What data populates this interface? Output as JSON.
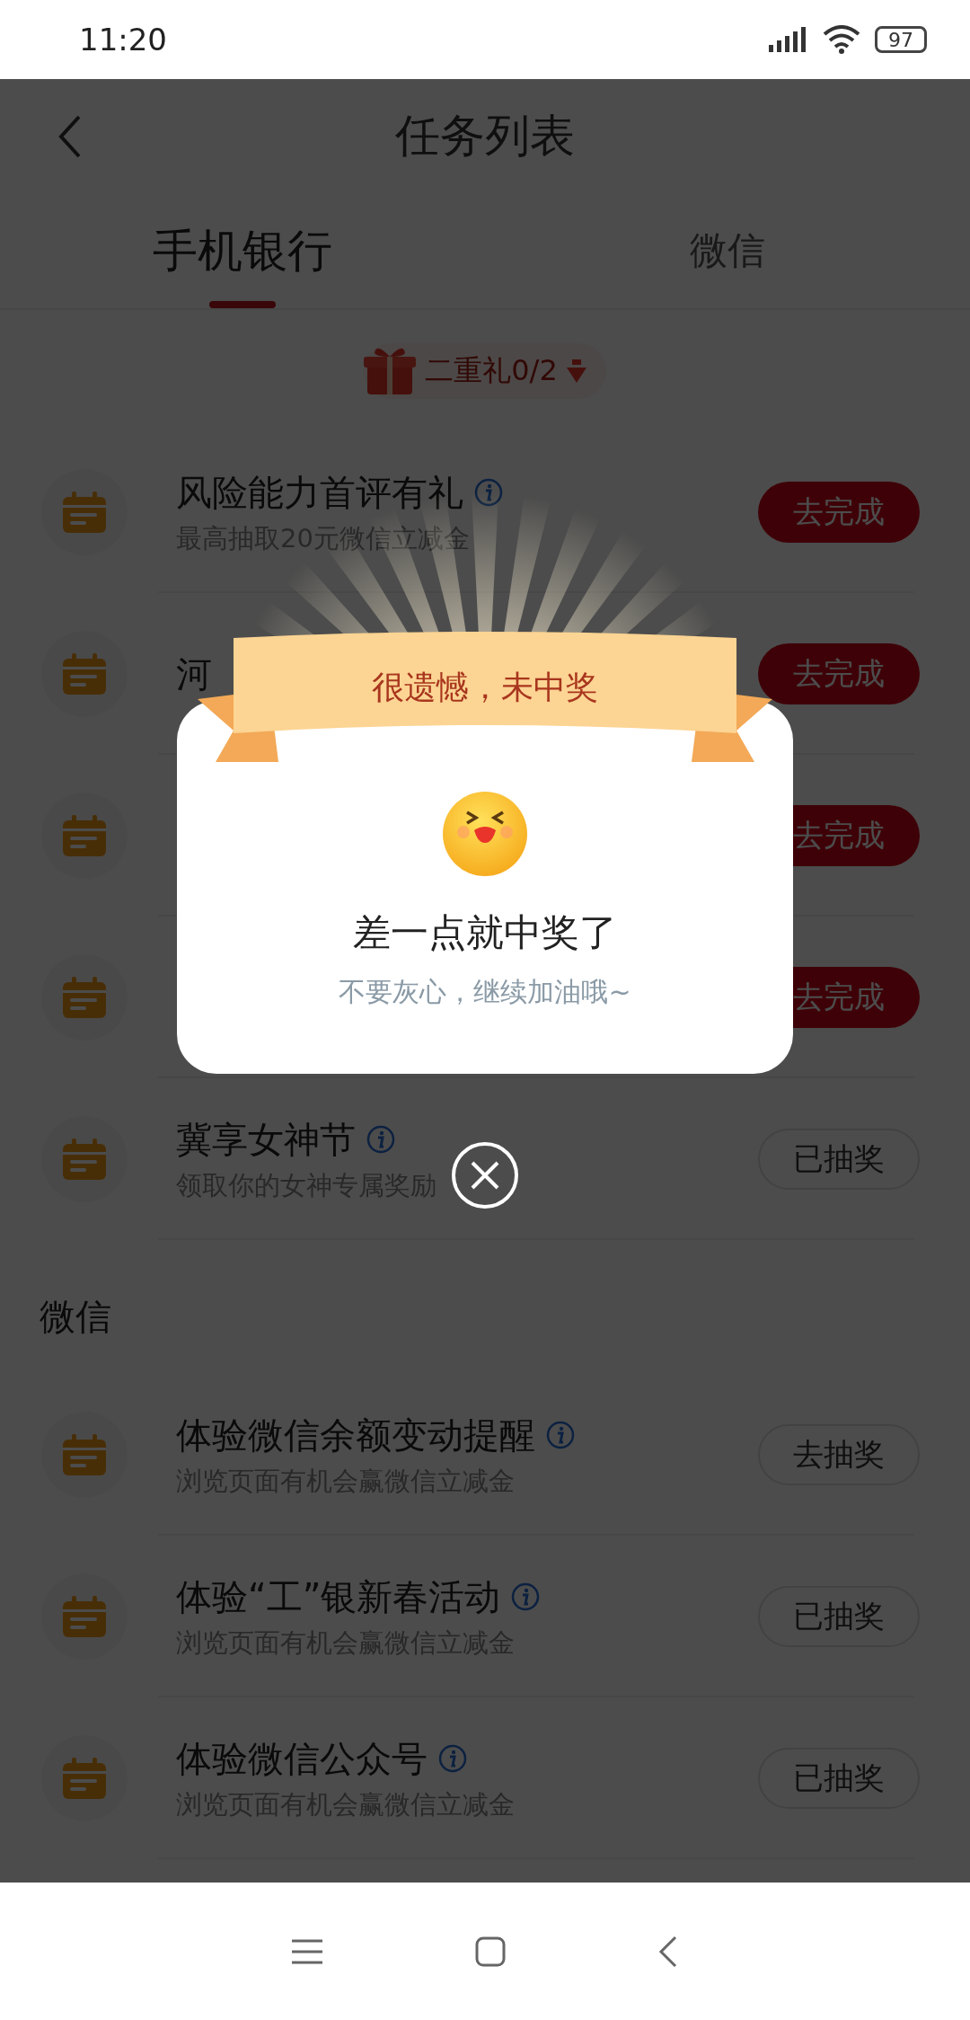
{
  "status_bar": {
    "time": "11:20",
    "battery": "97"
  },
  "header": {
    "title": "任务列表"
  },
  "tabs": [
    {
      "label": "手机银行",
      "selected": true
    },
    {
      "label": "微信",
      "selected": false
    }
  ],
  "gift_badge": {
    "label": "二重礼0/2"
  },
  "sections": [
    {
      "tasks": [
        {
          "title": "风险能力首评有礼",
          "info": true,
          "subtitle": "最高抽取20元微信立减金",
          "button": {
            "label": "去完成",
            "kind": "filled"
          }
        },
        {
          "title": "河",
          "info": false,
          "button": {
            "label": "去完成",
            "kind": "filled"
          }
        },
        {
          "info": false,
          "button": {
            "label": "去完成",
            "kind": "filled"
          }
        },
        {
          "info": false,
          "button": {
            "label": "去完成",
            "kind": "filled"
          }
        },
        {
          "title": "冀享女神节",
          "info": true,
          "subtitle": "领取你的女神专属奖励",
          "button": {
            "label": "已抽奖",
            "kind": "outline"
          }
        }
      ]
    },
    {
      "heading": "微信",
      "tasks": [
        {
          "title": "体验微信余额变动提醒",
          "info": true,
          "subtitle": "浏览页面有机会赢微信立减金",
          "button": {
            "label": "去抽奖",
            "kind": "outline"
          }
        },
        {
          "title": "体验“工”银新春活动",
          "info": true,
          "subtitle": "浏览页面有机会赢微信立减金",
          "button": {
            "label": "已抽奖",
            "kind": "outline"
          }
        },
        {
          "title": "体验微信公众号",
          "info": true,
          "subtitle": "浏览页面有机会赢微信立减金",
          "button": {
            "label": "已抽奖",
            "kind": "outline"
          }
        }
      ]
    }
  ],
  "dialog": {
    "banner": "很遗憾，未中奖",
    "title": "差一点就中奖了",
    "message": "不要灰心，继续加油哦~"
  }
}
